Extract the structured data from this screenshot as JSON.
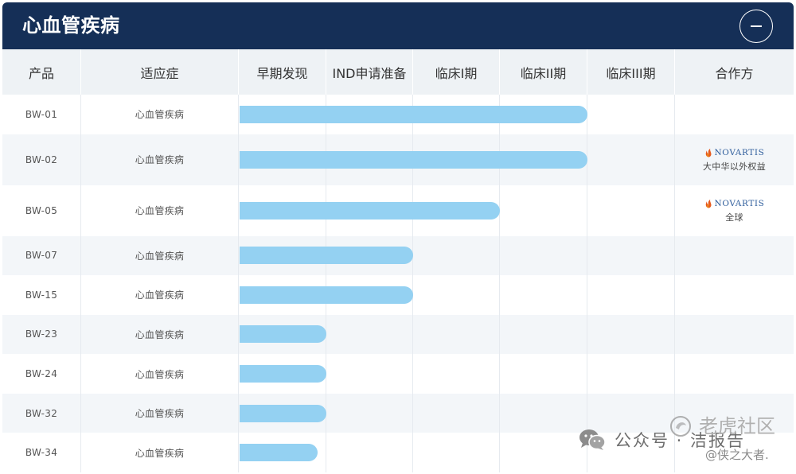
{
  "header": {
    "title": "心血管疾病",
    "collapse_icon": "minus-icon"
  },
  "columns": {
    "product": "产品",
    "indication": "适应症",
    "stages": [
      "早期发现",
      "IND申请准备",
      "临床I期",
      "临床II期",
      "临床III期"
    ],
    "partner": "合作方"
  },
  "colors": {
    "header_bg": "#152f57",
    "bar": "#94d1f2"
  },
  "rows": [
    {
      "product": "BW-01",
      "indication": "心血管疾病",
      "progress_stages": 4
    },
    {
      "product": "BW-02",
      "indication": "心血管疾病",
      "progress_stages": 4,
      "partner": {
        "logo_icon": "novartis-flame-icon",
        "name": "NOVARTIS",
        "rights": "大中华以外权益"
      }
    },
    {
      "product": "BW-05",
      "indication": "心血管疾病",
      "progress_stages": 3,
      "partner": {
        "logo_icon": "novartis-flame-icon",
        "name": "NOVARTIS",
        "rights": "全球"
      }
    },
    {
      "product": "BW-07",
      "indication": "心血管疾病",
      "progress_stages": 2
    },
    {
      "product": "BW-15",
      "indication": "心血管疾病",
      "progress_stages": 2
    },
    {
      "product": "BW-23",
      "indication": "心血管疾病",
      "progress_stages": 1
    },
    {
      "product": "BW-24",
      "indication": "心血管疾病",
      "progress_stages": 1
    },
    {
      "product": "BW-32",
      "indication": "心血管疾病",
      "progress_stages": 1
    },
    {
      "product": "BW-34",
      "indication": "心血管疾病",
      "progress_stages": 0.9
    }
  ],
  "watermark": {
    "wechat_icon": "wechat-icon",
    "wechat_label": "公众号 · 洁报告",
    "community_icon": "community-logo-icon",
    "community_label": "老虎社区",
    "handle": "@侠之大者."
  }
}
